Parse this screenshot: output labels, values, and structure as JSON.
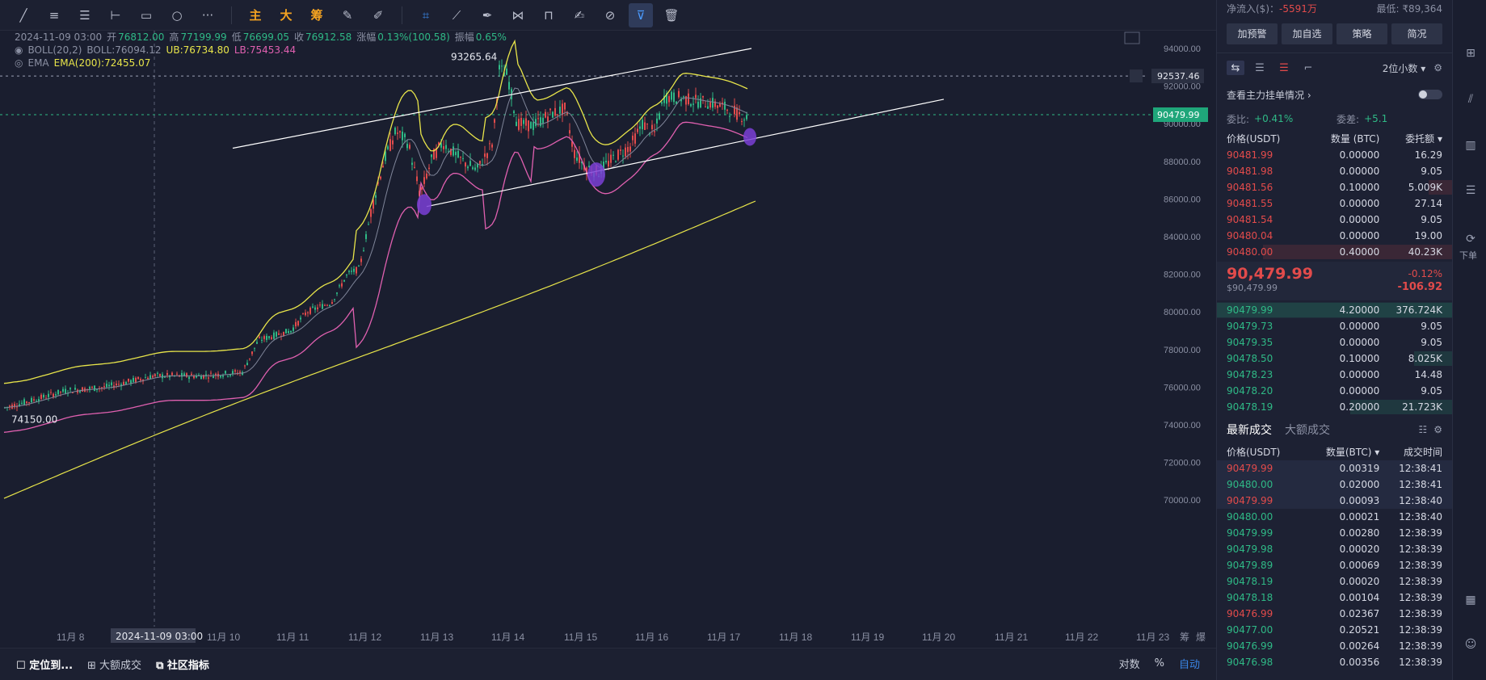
{
  "toolbar": {
    "draw_tools": [
      "line-tool-icon",
      "parallel-tool-icon",
      "fib-tool-icon",
      "horizontal-line-icon",
      "rectangle-icon",
      "ellipse-icon",
      "more-icon"
    ],
    "main_label": "主",
    "big_label": "大",
    "chips_label": "筹"
  },
  "indicators": {
    "ohlc": {
      "datetime": "2024-11-09 03:00",
      "open_label": "开",
      "open": "76812.00",
      "high_label": "高",
      "high": "77199.99",
      "low_label": "低",
      "low": "76699.05",
      "close_label": "收",
      "close": "76912.58",
      "chg_label": "涨幅",
      "chg": "0.13%(100.58)",
      "amp_label": "振幅",
      "amp": "0.65%"
    },
    "boll": {
      "name": "BOLL(20,2)",
      "mid": "BOLL:76094.12",
      "ub": "UB:76734.80",
      "lb": "LB:75453.44"
    },
    "ema": {
      "name": "EMA",
      "value": "EMA(200):72455.07"
    }
  },
  "chart": {
    "colors": {
      "up": "#2fb986",
      "down": "#e24b4b",
      "ub": "#e8e54a",
      "lb": "#e060b0",
      "mid": "#7f8599",
      "ema": "#e8e54a",
      "trend": "#ffffff",
      "marker": "#7b3fd6"
    },
    "price_labels": [
      "94000.00",
      "92000.00",
      "90000.00",
      "88000.00",
      "86000.00",
      "84000.00",
      "82000.00",
      "80000.00",
      "78000.00",
      "76000.00",
      "74000.00",
      "72000.00",
      "70000.00"
    ],
    "price_values": [
      94000,
      92000,
      90000,
      88000,
      86000,
      84000,
      82000,
      80000,
      78000,
      76000,
      74000,
      72000,
      70000
    ],
    "date_labels": [
      "11月 8",
      "11月 10",
      "11月 11",
      "11月 12",
      "11月 13",
      "11月 14",
      "11月 15",
      "11月 16",
      "11月 17",
      "11月 18",
      "11月 19",
      "11月 20",
      "11月 21",
      "11月 22",
      "11月 23"
    ],
    "crosshair_date": "2024-11-09 03:00",
    "high_marker": "93265.64",
    "low_marker": "74150.00",
    "dashed_level": "92537.46",
    "current_price": "90479.99",
    "axis_extra": [
      "筹",
      "爆"
    ]
  },
  "bottom_bar": {
    "locate": "定位到...",
    "big_trades": "大额成交",
    "community": "社区指标",
    "log": "对数",
    "pct": "%",
    "auto": "自动"
  },
  "panel": {
    "net_inflow_label": "净流入($)：",
    "net_inflow": "-5591万",
    "low_label": "最低:",
    "low": "₹89,364",
    "buttons": [
      "加预警",
      "加自选",
      "策略",
      "简况"
    ],
    "precision": "2位小数",
    "main_orders": "查看主力挂单情况",
    "ratio_label": "委比:",
    "ratio": "+0.41%",
    "diff_label": "委差:",
    "diff": "+5.1",
    "book_headers": [
      "价格(USDT)",
      "数量 (BTC)",
      "委托额"
    ],
    "asks": [
      {
        "p": "90481.99",
        "q": "0.00000",
        "v": "16.29"
      },
      {
        "p": "90481.98",
        "q": "0.00000",
        "v": "9.05"
      },
      {
        "p": "90481.56",
        "q": "0.10000",
        "v": "5.009K"
      },
      {
        "p": "90481.55",
        "q": "0.00000",
        "v": "27.14"
      },
      {
        "p": "90481.54",
        "q": "0.00000",
        "v": "9.05"
      },
      {
        "p": "90480.04",
        "q": "0.00000",
        "v": "19.00"
      },
      {
        "p": "90480.00",
        "q": "0.40000",
        "v": "40.23K"
      }
    ],
    "last_price": "90,479.99",
    "last_usd": "$90,479.99",
    "last_chg_pct": "-0.12%",
    "last_chg": "-106.92",
    "bids": [
      {
        "p": "90479.99",
        "q": "4.20000",
        "v": "376.724K"
      },
      {
        "p": "90479.73",
        "q": "0.00000",
        "v": "9.05"
      },
      {
        "p": "90479.35",
        "q": "0.00000",
        "v": "9.05"
      },
      {
        "p": "90478.50",
        "q": "0.10000",
        "v": "8.025K"
      },
      {
        "p": "90478.23",
        "q": "0.00000",
        "v": "14.48"
      },
      {
        "p": "90478.20",
        "q": "0.00000",
        "v": "9.05"
      },
      {
        "p": "90478.19",
        "q": "0.20000",
        "v": "21.723K"
      }
    ],
    "trades_tab": "最新成交",
    "big_tab": "大额成交",
    "trade_headers": [
      "价格(USDT)",
      "数量(BTC)",
      "成交时间"
    ],
    "trades": [
      {
        "p": "90479.99",
        "q": "0.00319",
        "t": "12:38:41",
        "side": "sell"
      },
      {
        "p": "90480.00",
        "q": "0.02000",
        "t": "12:38:41",
        "side": "buy"
      },
      {
        "p": "90479.99",
        "q": "0.00093",
        "t": "12:38:40",
        "side": "sell"
      },
      {
        "p": "90480.00",
        "q": "0.00021",
        "t": "12:38:40",
        "side": "buy"
      },
      {
        "p": "90479.99",
        "q": "0.00280",
        "t": "12:38:39",
        "side": "buy"
      },
      {
        "p": "90479.98",
        "q": "0.00020",
        "t": "12:38:39",
        "side": "buy"
      },
      {
        "p": "90479.89",
        "q": "0.00069",
        "t": "12:38:39",
        "side": "buy"
      },
      {
        "p": "90478.19",
        "q": "0.00020",
        "t": "12:38:39",
        "side": "buy"
      },
      {
        "p": "90478.18",
        "q": "0.00104",
        "t": "12:38:39",
        "side": "buy"
      },
      {
        "p": "90476.99",
        "q": "0.02367",
        "t": "12:38:39",
        "side": "sell"
      },
      {
        "p": "90477.00",
        "q": "0.20521",
        "t": "12:38:39",
        "side": "buy"
      },
      {
        "p": "90476.99",
        "q": "0.00264",
        "t": "12:38:39",
        "side": "buy"
      },
      {
        "p": "90476.98",
        "q": "0.00356",
        "t": "12:38:39",
        "side": "buy"
      }
    ]
  },
  "rail": {
    "download": "下单"
  }
}
